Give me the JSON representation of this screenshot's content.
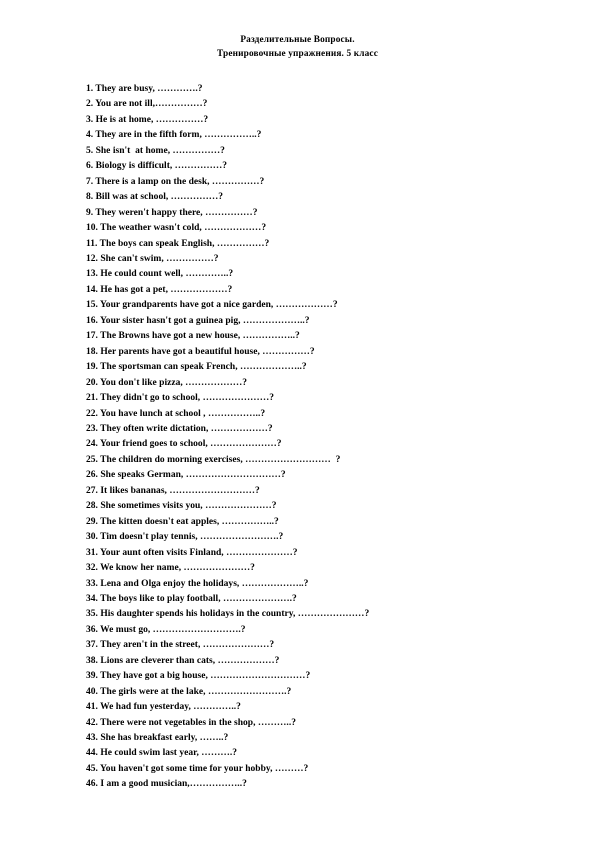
{
  "document": {
    "title_lines": [
      "Разделительные Вопросы.",
      "Тренировочные упражнения. 5 класс"
    ]
  },
  "exercises": [
    {
      "number": "1.",
      "text": "They are busy, ………….?"
    },
    {
      "number": "2.",
      "text": "You are not ill,……………?"
    },
    {
      "number": "3.",
      "text": "He is at home, ……………?"
    },
    {
      "number": "4.",
      "text": "They are in the fifth form, ……………..?"
    },
    {
      "number": "5.",
      "text": "She isn't  at home, ……………?"
    },
    {
      "number": "6.",
      "text": "Biology is difficult, ……………?"
    },
    {
      "number": "7.",
      "text": "There is a lamp on the desk, ……………?"
    },
    {
      "number": "8.",
      "text": "Bill was at school, ……………?"
    },
    {
      "number": "9.",
      "text": "They weren't happy there, ……………?"
    },
    {
      "number": "10.",
      "text": "The weather wasn't cold, ………………?"
    },
    {
      "number": "11.",
      "text": "The boys can speak English, ……………?"
    },
    {
      "number": "12.",
      "text": "She can't swim, ……………?"
    },
    {
      "number": "13.",
      "text": "He could count well, …………..?"
    },
    {
      "number": "14.",
      "text": "He has got a pet, ………………?"
    },
    {
      "number": "15.",
      "text": "Your grandparents have got a nice garden, ………………?"
    },
    {
      "number": "16.",
      "text": "Your sister hasn't got a guinea pig, ………………..?"
    },
    {
      "number": "17.",
      "text": "The Browns have got a new house, ……………..?"
    },
    {
      "number": "18.",
      "text": "Her parents have got a beautiful house, ……………?"
    },
    {
      "number": "19.",
      "text": "The sportsman can speak French, ………………..?"
    },
    {
      "number": "20.",
      "text": "You don't like pizza, ………………?"
    },
    {
      "number": "21.",
      "text": "They didn't go to school, …………………?"
    },
    {
      "number": "22.",
      "text": "You have lunch at school , ……………..?"
    },
    {
      "number": "23.",
      "text": "They often write dictation, ………………?"
    },
    {
      "number": "24.",
      "text": "Your friend goes to school, …………………?"
    },
    {
      "number": "25.",
      "text": "The children do morning exercises, ………………………  ?"
    },
    {
      "number": "26.",
      "text": "She speaks German, …………………………?"
    },
    {
      "number": "27.",
      "text": "It likes bananas, ………………………?"
    },
    {
      "number": "28.",
      "text": "She sometimes visits you, …………………?"
    },
    {
      "number": "29.",
      "text": "The kitten doesn't eat apples, ……………..?"
    },
    {
      "number": "30.",
      "text": "Tim doesn't play tennis, …………………….?"
    },
    {
      "number": "31.",
      "text": "Your aunt often visits Finland, …………………?"
    },
    {
      "number": "32.",
      "text": "We know her name, …………………?"
    },
    {
      "number": "33.",
      "text": "Lena and Olga enjoy the holidays, ………………..?"
    },
    {
      "number": "34.",
      "text": "The boys like to play football, ………………….?"
    },
    {
      "number": "35.",
      "text": "His daughter spends his holidays in the country, …………………?"
    },
    {
      "number": "36.",
      "text": "We must go, ……………………….?"
    },
    {
      "number": "37.",
      "text": "They aren't in the street, …………………?"
    },
    {
      "number": "38.",
      "text": "Lions are cleverer than cats, ………………?"
    },
    {
      "number": "39.",
      "text": "They have got a big house, …………………………?"
    },
    {
      "number": "40.",
      "text": "The girls were at the lake, …………………….?"
    },
    {
      "number": "41.",
      "text": "We had fun yesterday, …………..?"
    },
    {
      "number": "42.",
      "text": "There were not vegetables in the shop, ………..?"
    },
    {
      "number": "43.",
      "text": "She has breakfast early, ……..?"
    },
    {
      "number": "44.",
      "text": "He could swim last year, ……….?"
    },
    {
      "number": "45.",
      "text": "You haven't got some time for your hobby, ………?"
    },
    {
      "number": "46.",
      "text": "I am a good musician,……………..?"
    }
  ]
}
